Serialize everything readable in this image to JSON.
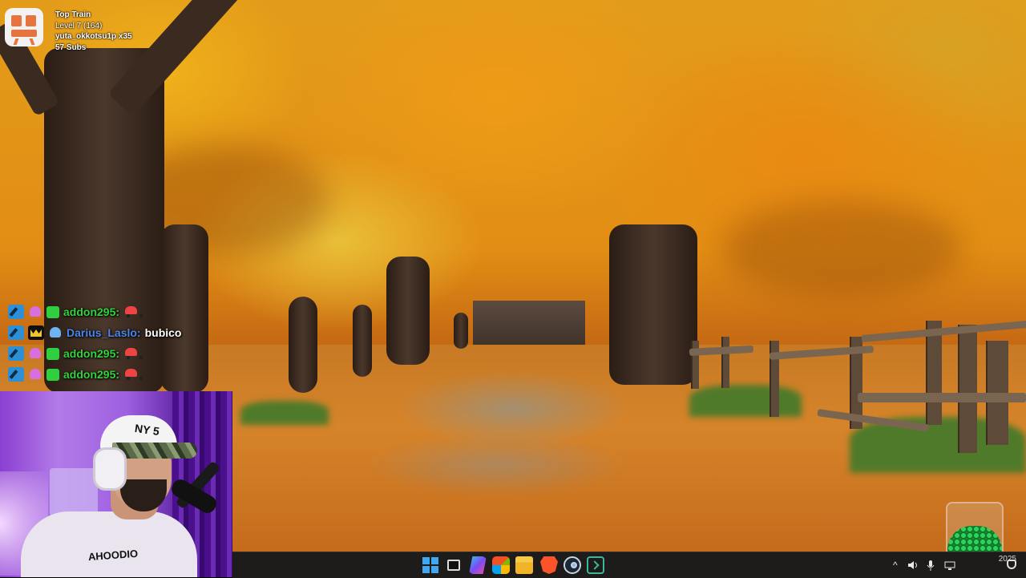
{
  "overlay": {
    "train": {
      "title": "Top Train",
      "level": "Level 7 (164)",
      "top_user": "yuta_okkotsu1p x35",
      "subs": "57 Subs"
    },
    "chat": [
      {
        "badges": [
          "mod-icon",
          "alien-icon",
          "sub-icon"
        ],
        "user": "addon295:",
        "user_color": "#34d13e",
        "message": "",
        "emote": "car-emote"
      },
      {
        "badges": [
          "mod-icon",
          "crown-icon",
          "alien-icon"
        ],
        "user": "Darius_Laslo:",
        "user_color": "#4a86e8",
        "message": "bubico",
        "emote": ""
      },
      {
        "badges": [
          "mod-icon",
          "alien-icon",
          "sub-icon"
        ],
        "user": "addon295:",
        "user_color": "#34d13e",
        "message": "",
        "emote": "car-emote"
      },
      {
        "badges": [
          "mod-icon",
          "alien-icon",
          "sub-icon"
        ],
        "user": "addon295:",
        "user_color": "#34d13e",
        "message": "",
        "emote": "car-emote"
      }
    ],
    "webcam": {
      "cap_text": "NY 5",
      "shirt_text": "AHOODIO"
    }
  },
  "taskbar": {
    "apps": [
      {
        "name": "start-icon"
      },
      {
        "name": "task-view-icon"
      },
      {
        "name": "copilot-icon"
      },
      {
        "name": "store-icon"
      },
      {
        "name": "file-explorer-icon"
      },
      {
        "name": "brave-browser-icon"
      },
      {
        "name": "steam-icon",
        "active": true
      },
      {
        "name": "terminal-icon"
      }
    ],
    "tray": {
      "chevron": "^",
      "date": "2025"
    }
  },
  "colors": {
    "accent": "#3fa8f0",
    "taskbar_bg": "#1d1c1b",
    "chat_green": "#34d13e",
    "chat_blue": "#4a86e8"
  }
}
